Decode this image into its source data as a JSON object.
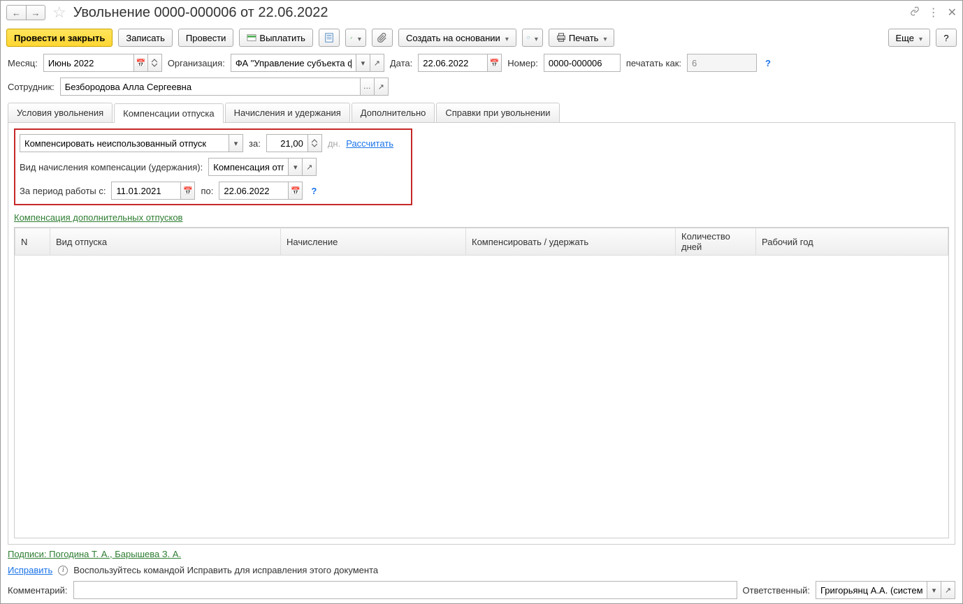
{
  "titlebar": {
    "title": "Увольнение 0000-000006 от 22.06.2022"
  },
  "toolbar": {
    "post_close": "Провести и закрыть",
    "save": "Записать",
    "post": "Провести",
    "pay": "Выплатить",
    "create_based": "Создать на основании",
    "print": "Печать",
    "more": "Еще",
    "help": "?"
  },
  "header": {
    "month_label": "Месяц:",
    "month_value": "Июнь 2022",
    "org_label": "Организация:",
    "org_value": "ФА \"Управление субъекта фе",
    "date_label": "Дата:",
    "date_value": "22.06.2022",
    "number_label": "Номер:",
    "number_value": "0000-000006",
    "print_as_label": "печатать как:",
    "print_as_value": "6",
    "employee_label": "Сотрудник:",
    "employee_value": "Безбородова Алла Сергеевна"
  },
  "tabs": {
    "t1": "Условия увольнения",
    "t2": "Компенсации отпуска",
    "t3": "Начисления и удержания",
    "t4": "Дополнительно",
    "t5": "Справки при увольнении"
  },
  "comp": {
    "action_value": "Компенсировать неиспользованный отпуск",
    "for_label": "за:",
    "days_value": "21,00",
    "days_unit": "дн.",
    "calc_link": "Рассчитать",
    "type_label": "Вид начисления компенсации (удержания):",
    "type_value": "Компенсация отпус",
    "period_label": "За период работы с:",
    "period_from": "11.01.2021",
    "period_to_label": "по:",
    "period_to": "22.06.2022"
  },
  "section": {
    "title": "Компенсация дополнительных отпусков"
  },
  "table": {
    "col_n": "N",
    "col_type": "Вид отпуска",
    "col_accrual": "Начисление",
    "col_comp": "Компенсировать / удержать",
    "col_days": "Количество дней",
    "col_year": "Рабочий год"
  },
  "footer": {
    "signatures": "Подписи: Погодина Т. А., Барышева З. А.",
    "fix_link": "Исправить",
    "fix_hint": "Воспользуйтесь командой Исправить для исправления этого документа",
    "comment_label": "Комментарий:",
    "responsible_label": "Ответственный:",
    "responsible_value": "Григорьянц А.А. (системн"
  }
}
